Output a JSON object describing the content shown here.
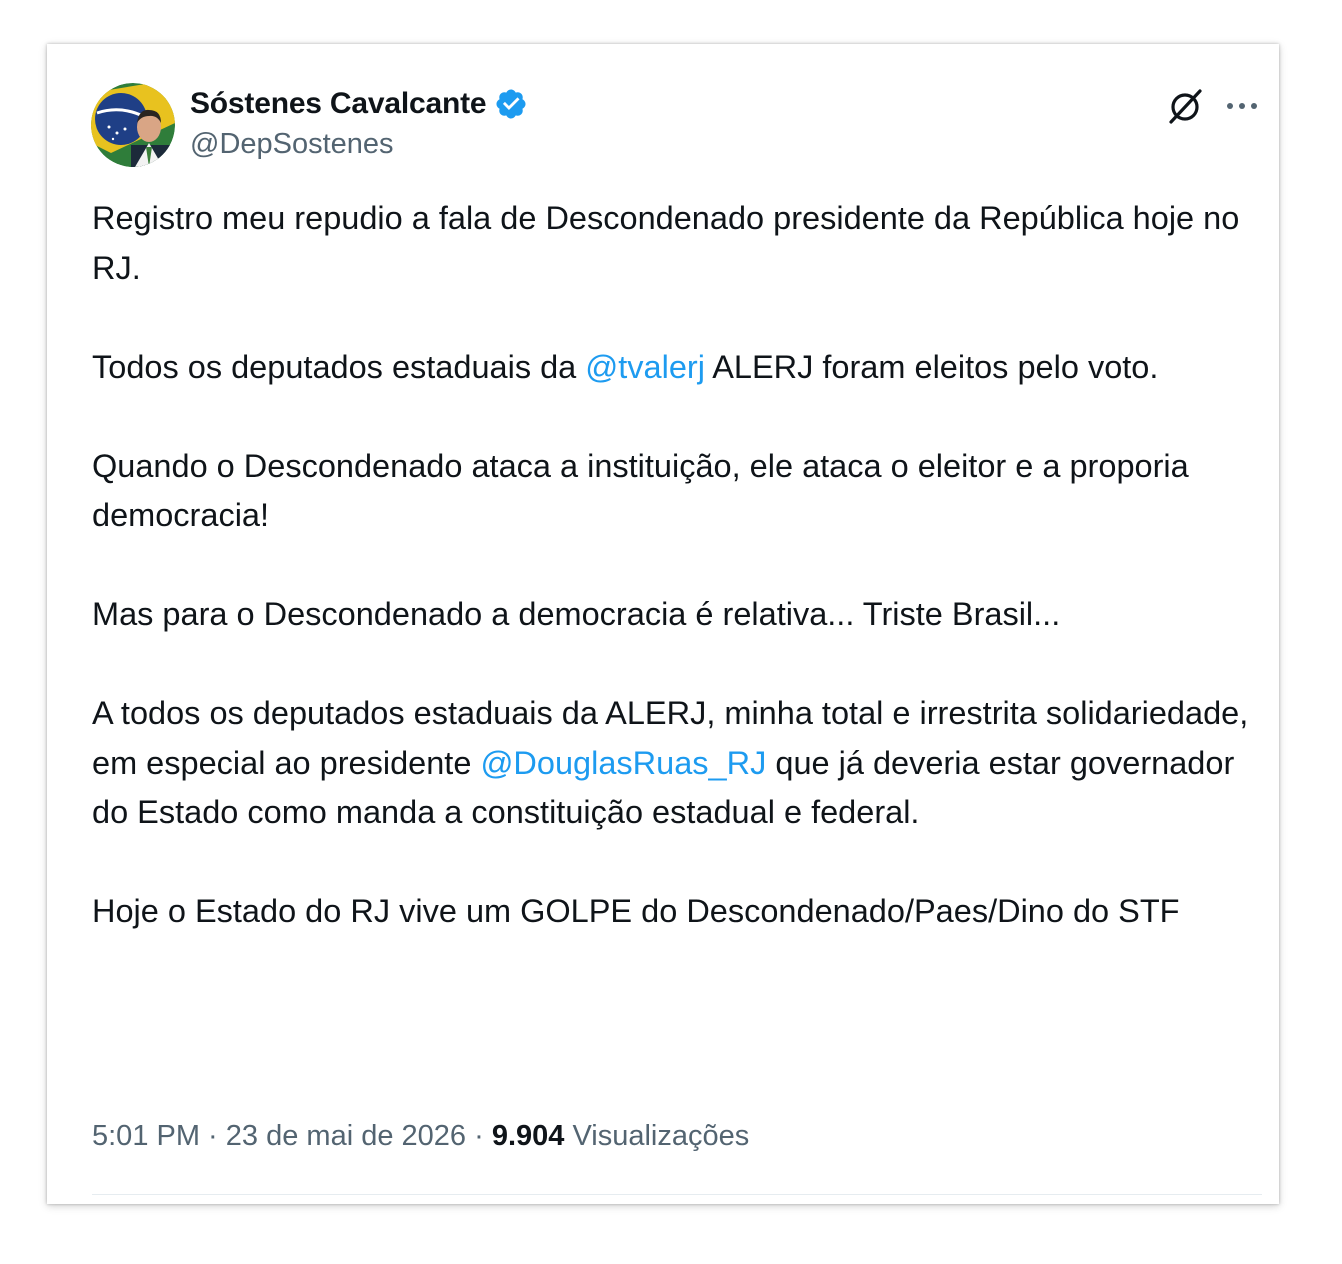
{
  "author": {
    "display_name": "Sóstenes Cavalcante",
    "handle": "@DepSostenes",
    "avatar_icon": "profile-photo",
    "verified_icon": "verified-badge-icon"
  },
  "header_actions": {
    "grok_icon": "grok-icon",
    "more_icon": "more-options-icon"
  },
  "tweet": {
    "p1": "Registro meu repudio a fala de Descondenado presidente da República hoje no RJ.",
    "p2_before": "Todos os deputados estaduais da ",
    "p2_mention": "@tvalerj",
    "p2_after": " ALERJ foram eleitos pelo voto.",
    "p3": "Quando o Descondenado ataca a instituição, ele ataca o eleitor e a proporia democracia!",
    "p4": "Mas para o Descondenado a democracia é relativa... Triste Brasil...",
    "p5_before": "A todos os deputados estaduais da ALERJ, minha total e irrestrita solidariedade, em especial ao presidente ",
    "p5_mention": "@DouglasRuas_RJ",
    "p5_after": " que já deveria estar governador do Estado como manda a constituição estadual e federal.",
    "p6": "Hoje o Estado do RJ vive um GOLPE do Descondenado/Paes/Dino do STF"
  },
  "meta": {
    "time": "5:01 PM",
    "separator": " · ",
    "date": "23 de mai de 2026",
    "views_count": "9.904",
    "views_label": "Visualizações"
  },
  "colors": {
    "text": "#0f1419",
    "secondary": "#536471",
    "link": "#1d9bf0",
    "verified": "#1d9bf0"
  }
}
